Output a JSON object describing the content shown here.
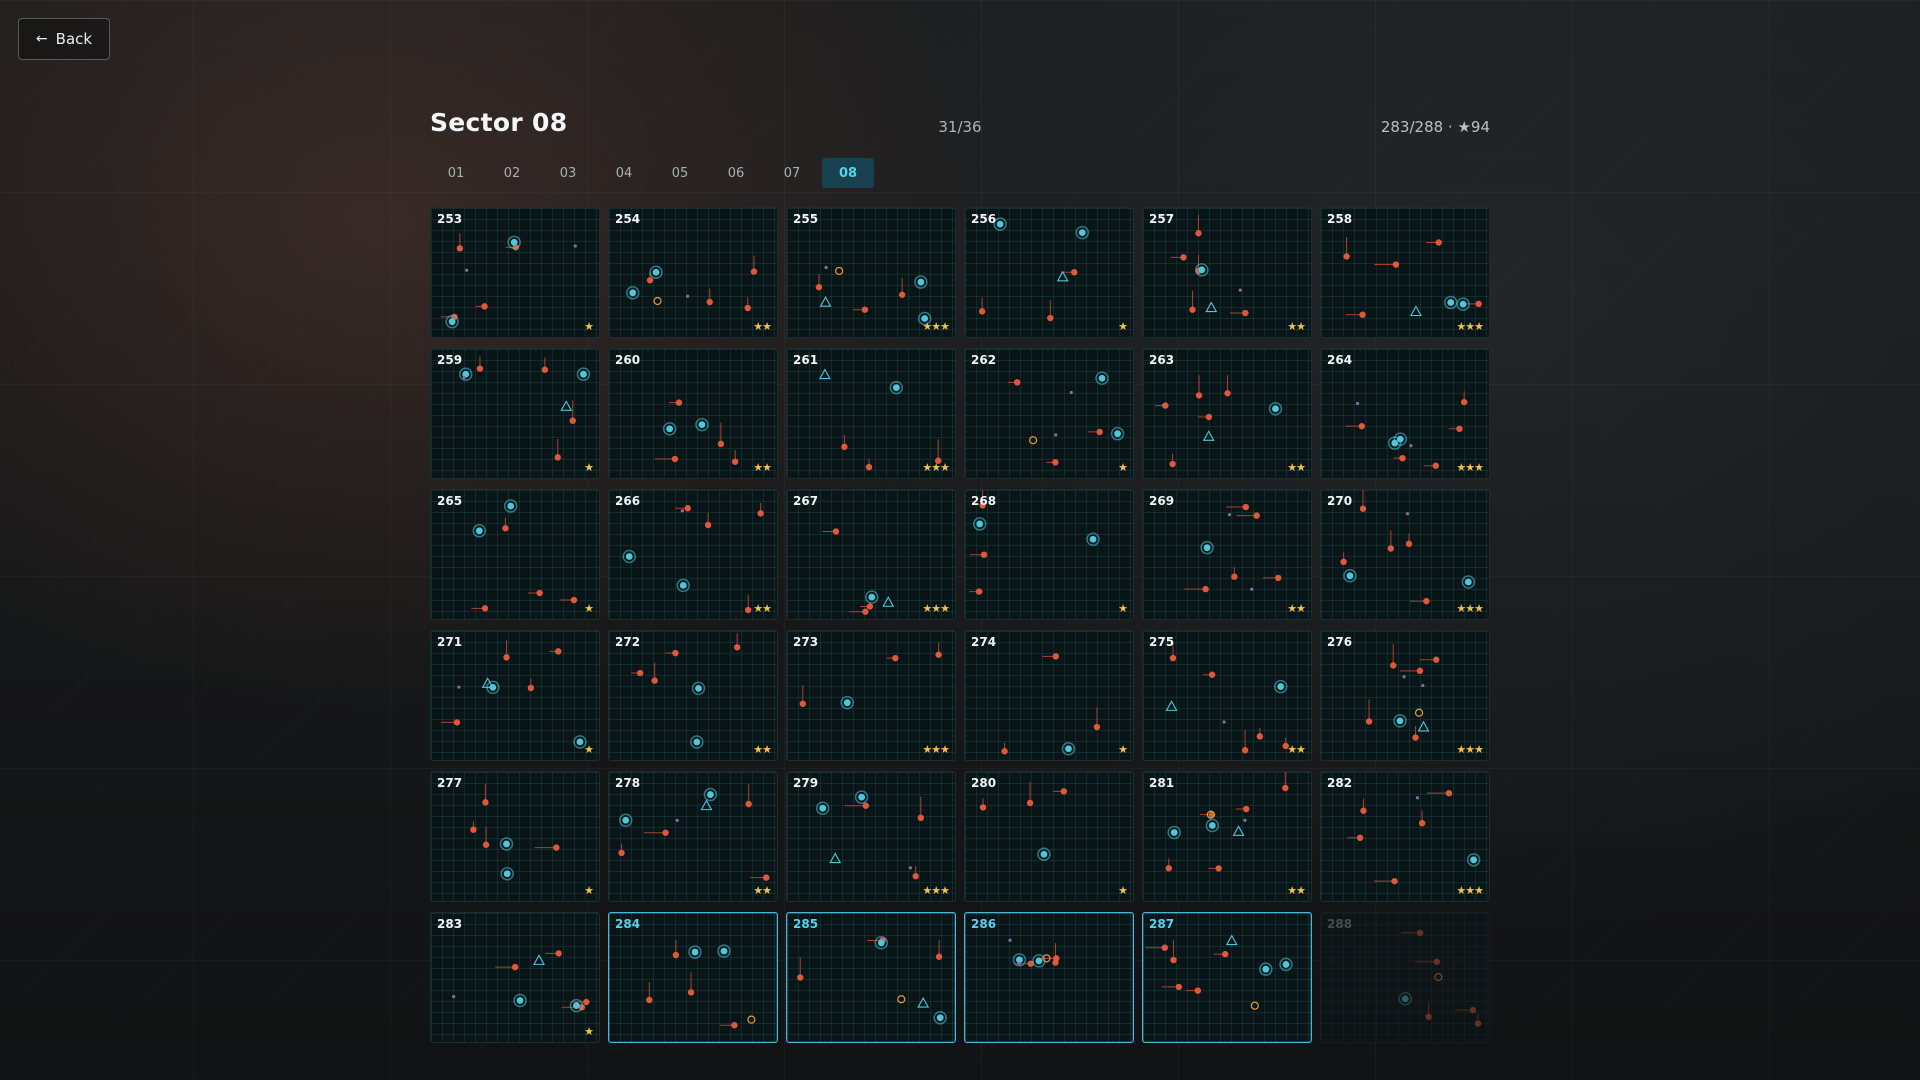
{
  "back": {
    "label": "Back",
    "icon": "arrow-left-icon"
  },
  "header": {
    "title": "Sector 08",
    "counter": "31/36",
    "totals": "283/288 · ★94"
  },
  "tabs": [
    {
      "label": "01",
      "active": false
    },
    {
      "label": "02",
      "active": false
    },
    {
      "label": "03",
      "active": false
    },
    {
      "label": "04",
      "active": false
    },
    {
      "label": "05",
      "active": false
    },
    {
      "label": "06",
      "active": false
    },
    {
      "label": "07",
      "active": false
    },
    {
      "label": "08",
      "active": true
    }
  ],
  "colors": {
    "red": "#e0583b",
    "cyan": "#4cc7db",
    "purple": "#8a6aa8",
    "orange": "#e89a3a",
    "star": "#f2c14a",
    "accent": "#46b9d9"
  },
  "levels": [
    {
      "num": "253",
      "stars": "★"
    },
    {
      "num": "254",
      "stars": "★★"
    },
    {
      "num": "255",
      "stars": "★★★"
    },
    {
      "num": "256",
      "stars": "★"
    },
    {
      "num": "257",
      "stars": "★★"
    },
    {
      "num": "258",
      "stars": "★★★"
    },
    {
      "num": "259",
      "stars": "★"
    },
    {
      "num": "260",
      "stars": "★★"
    },
    {
      "num": "261",
      "stars": "★★★"
    },
    {
      "num": "262",
      "stars": "★"
    },
    {
      "num": "263",
      "stars": "★★"
    },
    {
      "num": "264",
      "stars": "★★★"
    },
    {
      "num": "265",
      "stars": "★"
    },
    {
      "num": "266",
      "stars": "★★"
    },
    {
      "num": "267",
      "stars": "★★★"
    },
    {
      "num": "268",
      "stars": "★"
    },
    {
      "num": "269",
      "stars": "★★"
    },
    {
      "num": "270",
      "stars": "★★★"
    },
    {
      "num": "271",
      "stars": "★"
    },
    {
      "num": "272",
      "stars": "★★"
    },
    {
      "num": "273",
      "stars": "★★★"
    },
    {
      "num": "274",
      "stars": "★"
    },
    {
      "num": "275",
      "stars": "★★"
    },
    {
      "num": "276",
      "stars": "★★★"
    },
    {
      "num": "277",
      "stars": "★"
    },
    {
      "num": "278",
      "stars": "★★"
    },
    {
      "num": "279",
      "stars": "★★★"
    },
    {
      "num": "280",
      "stars": "★"
    },
    {
      "num": "281",
      "stars": "★★"
    },
    {
      "num": "282",
      "stars": "★★★"
    },
    {
      "num": "283",
      "stars": "★"
    },
    {
      "num": "284",
      "stars": "",
      "state": "current"
    },
    {
      "num": "285",
      "stars": "",
      "state": "current"
    },
    {
      "num": "286",
      "stars": "",
      "state": "current"
    },
    {
      "num": "287",
      "stars": "",
      "state": "current"
    },
    {
      "num": "288",
      "stars": "",
      "state": "locked"
    }
  ]
}
